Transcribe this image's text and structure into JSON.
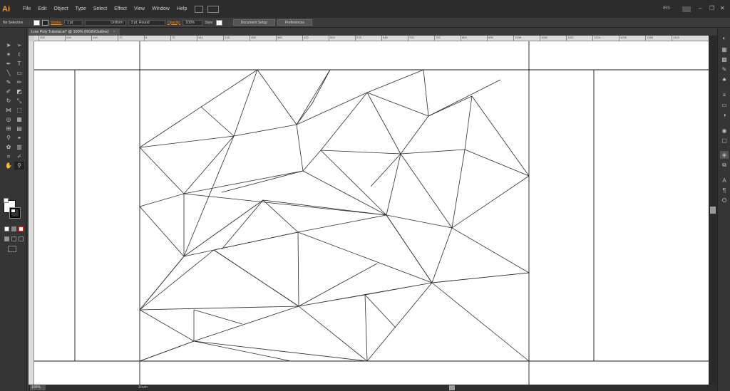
{
  "app": {
    "logo": "Ai",
    "menus": [
      "File",
      "Edit",
      "Object",
      "Type",
      "Select",
      "Effect",
      "View",
      "Window",
      "Help"
    ],
    "workspace": "IRS",
    "window_controls": [
      "–",
      "❐",
      "✕"
    ]
  },
  "control_bar": {
    "selection": "No Selection",
    "stroke_label": "Stroke:",
    "stroke_weight": "1 pt",
    "profile": "Uniform",
    "brush": "3 pt. Round",
    "opacity_label": "Opacity:",
    "opacity_value": "100%",
    "style_label": "Style:",
    "document_setup": "Document Setup",
    "preferences": "Preferences"
  },
  "document": {
    "tab_title": "Low Poly Tutorial.ai* @ 100% (RGB/Outline)",
    "tab_close": "×"
  },
  "ruler": {
    "labels": [
      "288",
      "216",
      "144",
      "72",
      "0",
      "72",
      "144",
      "216",
      "288",
      "360",
      "432",
      "504",
      "576",
      "648",
      "720",
      "792",
      "864",
      "936",
      "1008",
      "1080",
      "1152",
      "1224",
      "1296",
      "1368",
      "1440"
    ]
  },
  "status": {
    "zoom": "100%",
    "tool_name": "Zoom"
  },
  "icons": {
    "selection": "selection-arrow-icon",
    "direct": "direct-selection-icon",
    "pen": "pen-icon",
    "type": "type-icon",
    "line": "line-segment-icon",
    "rect": "rectangle-icon",
    "brush": "paintbrush-icon",
    "pencil": "pencil-icon",
    "hand": "hand-icon",
    "zoom": "zoom-icon"
  },
  "colors": {
    "accent": "#e58b2b",
    "background": "#3a3a3a",
    "artboard": "#ffffff"
  }
}
